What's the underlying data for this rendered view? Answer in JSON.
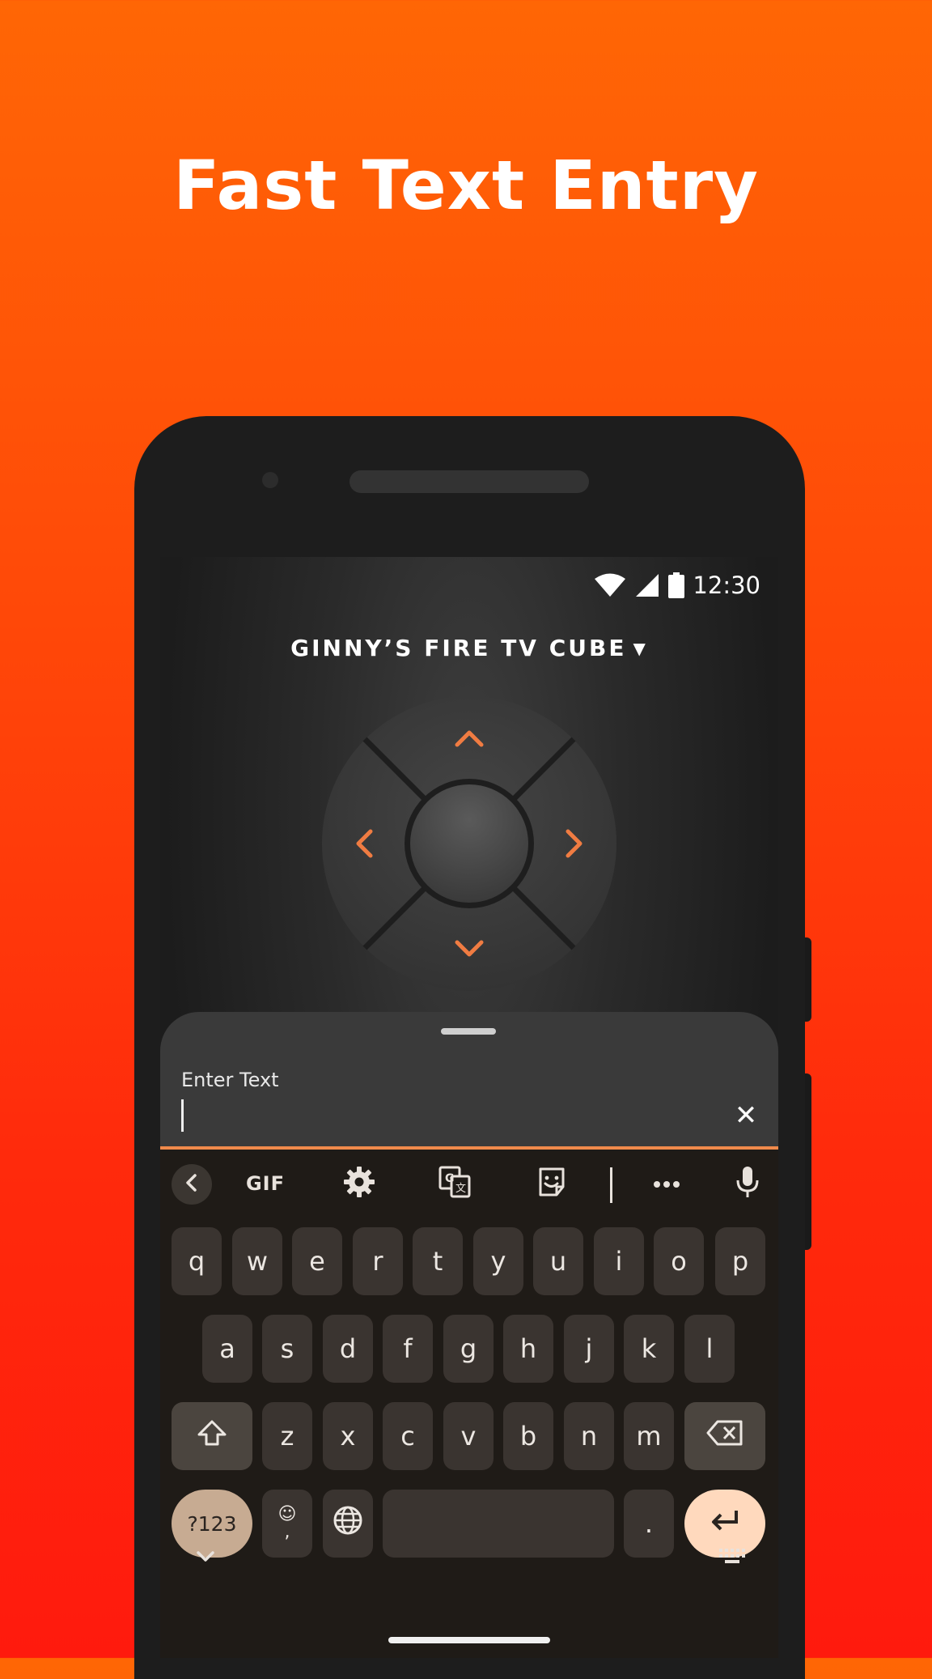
{
  "headline": "Fast Text Entry",
  "status_bar": {
    "time": "12:30"
  },
  "remote": {
    "device_name": "GINNY’S FIRE TV CUBE",
    "caret": "▼",
    "accent": "#f07c42"
  },
  "text_entry": {
    "label": "Enter Text",
    "value": "",
    "clear": "✕"
  },
  "keyboard": {
    "toolbar": [
      "back",
      "GIF",
      "settings",
      "translate",
      "sticker",
      "more",
      "mic"
    ],
    "gif_label": "GIF",
    "row1": [
      "q",
      "w",
      "e",
      "r",
      "t",
      "y",
      "u",
      "i",
      "o",
      "p"
    ],
    "row2": [
      "a",
      "s",
      "d",
      "f",
      "g",
      "h",
      "j",
      "k",
      "l"
    ],
    "row3": [
      "z",
      "x",
      "c",
      "v",
      "b",
      "n",
      "m"
    ],
    "symbols_label": "?123",
    "emoji_top": "☺",
    "emoji_bottom": ",",
    "period": ".",
    "colors": {
      "key": "#3a3430",
      "symbols_key": "#c7ab92",
      "enter_key": "#ffd9bd"
    }
  }
}
